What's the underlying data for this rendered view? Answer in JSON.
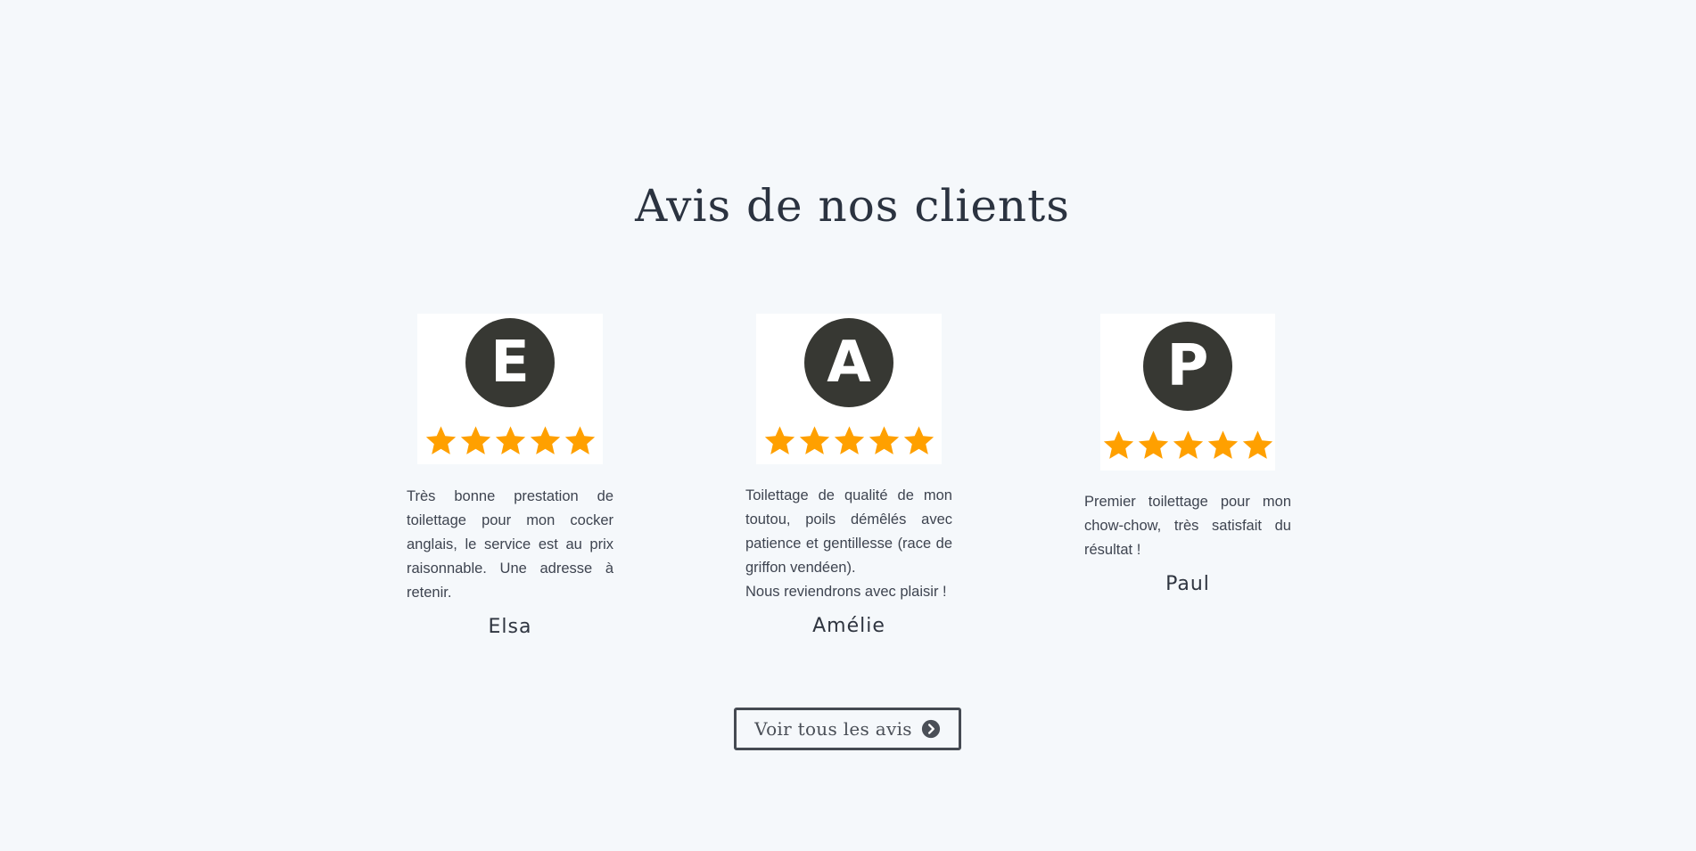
{
  "section": {
    "title": "Avis de nos clients"
  },
  "reviews": [
    {
      "initial": "E",
      "rating": 5,
      "text": "Très bonne prestation de toilettage pour mon cocker anglais, le service est au prix raisonnable. Une adresse à retenir.",
      "author": "Elsa"
    },
    {
      "initial": "A",
      "rating": 5,
      "text": "Toilettage de qualité de mon toutou, poils démêlés avec patience et gentillesse (race de griffon vendéen).\nNous reviendrons avec plaisir !",
      "author": "Amélie"
    },
    {
      "initial": "P",
      "rating": 5,
      "text": "Premier toilettage pour mon chow-chow, très satisfait du résultat !",
      "author": "Paul"
    }
  ],
  "cta": {
    "label": "Voir tous les avis",
    "icon": "chevron-circle-right-icon"
  },
  "colors": {
    "background": "#f5f8fb",
    "star": "#ffa000",
    "avatar": "#373833",
    "heading": "#2b3340"
  }
}
